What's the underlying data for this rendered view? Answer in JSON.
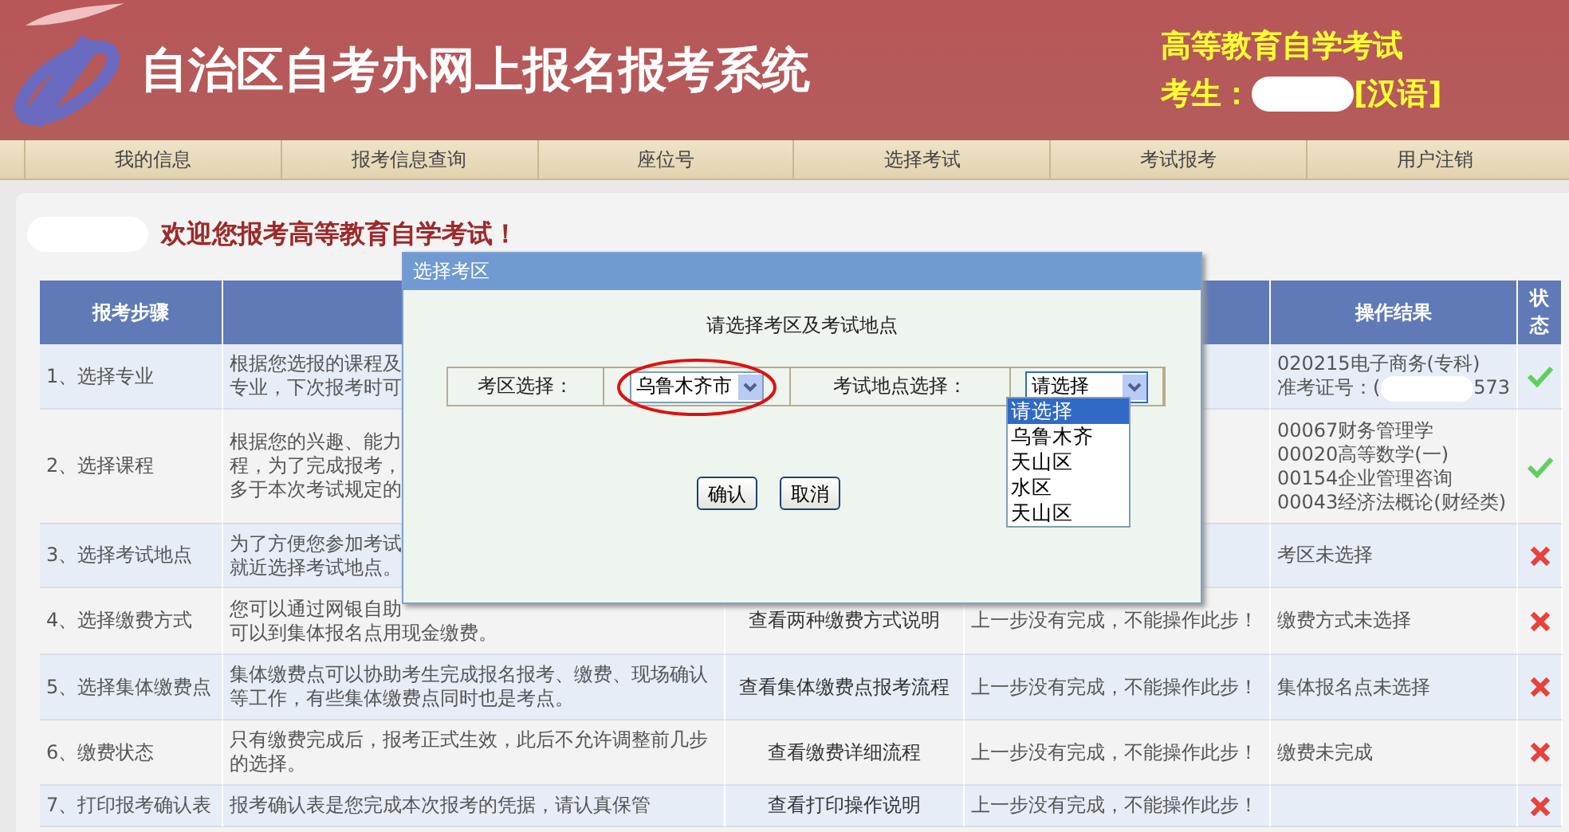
{
  "header": {
    "title": "自治区自考办网上报名报考系统",
    "subtitle": "高等教育自学考试",
    "candidate_label": "考生：",
    "language": "[汉语]"
  },
  "nav": [
    "我的信息",
    "报考信息查询",
    "座位号",
    "选择考试",
    "考试报考",
    "用户注销"
  ],
  "welcome": "欢迎您报考高等教育自学考试！",
  "table": {
    "step_header": "报考步骤",
    "result_header": "操作结果",
    "status_header": "状态",
    "rows": [
      {
        "step": "1、选择专业",
        "description": [
          "根据您选报的课程及",
          "专业，下次报考时可"
        ],
        "result": [
          {
            "text": "020215电子商务(专科)"
          },
          {
            "text": "准考证号：(",
            "after": "573"
          }
        ],
        "completed": true
      },
      {
        "step": "2、选择课程",
        "description": [
          "根据您的兴趣、能力",
          "程，为了完成报考，",
          "多于本次考试规定的"
        ],
        "result": [
          {
            "text": "00067财务管理学"
          },
          {
            "text": "00020高等数学(一)"
          },
          {
            "text": "00154企业管理咨询"
          },
          {
            "text": "00043经济法概论(财经类)"
          }
        ],
        "completed": true
      },
      {
        "step": "3、选择考试地点",
        "description": [
          "为了方便您参加考试",
          "就近选择考试地点。"
        ],
        "result": [
          {
            "text": "考区未选择"
          }
        ],
        "completed": false
      },
      {
        "step": "4、选择缴费方式",
        "description": [
          "您可以通过网银自助",
          "可以到集体报名点用现金缴费。"
        ],
        "action": "查看两种缴费方式说明",
        "info": "上一步没有完成，不能操作此步！",
        "result": [
          {
            "text": "缴费方式未选择"
          }
        ],
        "completed": false
      },
      {
        "step": "5、选择集体缴费点",
        "description": [
          "集体缴费点可以协助考生完成报名报考、缴费、现场确认",
          "等工作，有些集体缴费点同时也是考点。"
        ],
        "action": "查看集体缴费点报考流程",
        "info": "上一步没有完成，不能操作此步！",
        "result": [
          {
            "text": "集体报名点未选择"
          }
        ],
        "completed": false
      },
      {
        "step": "6、缴费状态",
        "description": [
          "只有缴费完成后，报考正式生效，此后不允许调整前几步",
          "的选择。"
        ],
        "action": "查看缴费详细流程",
        "info": "上一步没有完成，不能操作此步！",
        "result": [
          {
            "text": "缴费未完成"
          }
        ],
        "completed": false
      },
      {
        "step": "7、打印报考确认表",
        "description": [
          "报考确认表是您完成本次报考的凭据，请认真保管"
        ],
        "action": "查看打印操作说明",
        "info": "上一步没有完成，不能操作此步！",
        "completed": false
      }
    ]
  },
  "dialog": {
    "title": "选择考区",
    "prompt": "请选择考区及考试地点",
    "area_label": "考区选择：",
    "area_value": "乌鲁木齐市",
    "site_label": "考试地点选择：",
    "site_value": "请选择",
    "site_expanded": true,
    "site_options": [
      {
        "label": "请选择",
        "selected": true
      },
      {
        "label": "乌鲁木齐",
        "selected": false
      },
      {
        "label": "天山区",
        "selected": false
      },
      {
        "label": "水区",
        "selected": false
      },
      {
        "label": "天山区",
        "selected": false
      }
    ],
    "buttons": [
      "确认",
      "取消"
    ]
  }
}
